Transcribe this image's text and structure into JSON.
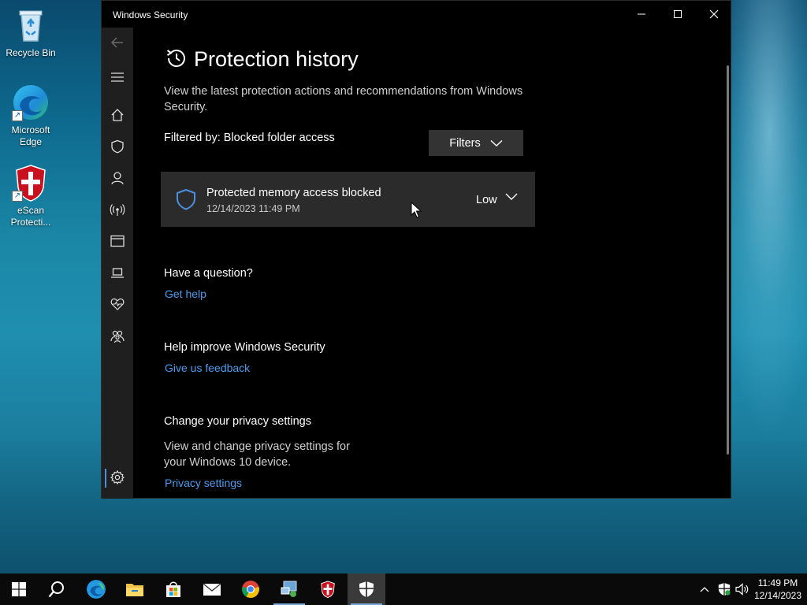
{
  "desktop": {
    "icons": [
      {
        "label": "Recycle Bin"
      },
      {
        "label": "Microsoft Edge"
      },
      {
        "label": "eScan Protecti..."
      }
    ]
  },
  "window": {
    "title": "Windows Security",
    "controls": {
      "minimize": "minimize-icon",
      "maximize": "maximize-icon",
      "close": "close-icon"
    }
  },
  "sidebar": {
    "items": [
      {
        "icon": "back-arrow-icon"
      },
      {
        "icon": "hamburger-menu-icon"
      },
      {
        "icon": "home-icon"
      },
      {
        "icon": "shield-icon"
      },
      {
        "icon": "person-icon"
      },
      {
        "icon": "wireless-icon"
      },
      {
        "icon": "app-browser-icon"
      },
      {
        "icon": "laptop-icon"
      },
      {
        "icon": "heart-pulse-icon"
      },
      {
        "icon": "family-icon"
      },
      {
        "icon": "settings-gear-icon"
      }
    ]
  },
  "page": {
    "title": "Protection history",
    "description": "View the latest protection actions and recommendations from Windows Security.",
    "filtered_by": "Filtered by: Blocked folder access",
    "filters_label": "Filters",
    "events": [
      {
        "title": "Protected memory access blocked",
        "time": "12/14/2023 11:49 PM",
        "severity": "Low"
      }
    ],
    "question": {
      "heading": "Have a question?",
      "link": "Get help"
    },
    "improve": {
      "heading": "Help improve Windows Security",
      "link": "Give us feedback"
    },
    "privacy": {
      "heading": "Change your privacy settings",
      "description": "View and change privacy settings for your Windows 10 device.",
      "link": "Privacy settings"
    }
  },
  "taskbar": {
    "apps": [
      "start-icon",
      "search-icon",
      "edge-icon",
      "file-explorer-icon",
      "store-icon",
      "mail-icon",
      "chrome-icon",
      "network-tool-icon",
      "escan-icon",
      "windows-security-icon"
    ],
    "clock": {
      "time": "11:49 PM",
      "date": "12/14/2023"
    }
  },
  "colors": {
    "accent": "#4a9cf0",
    "window_bg": "#000000",
    "sidebar_bg": "#1f1f1f",
    "card_bg": "#2b2b2b"
  }
}
